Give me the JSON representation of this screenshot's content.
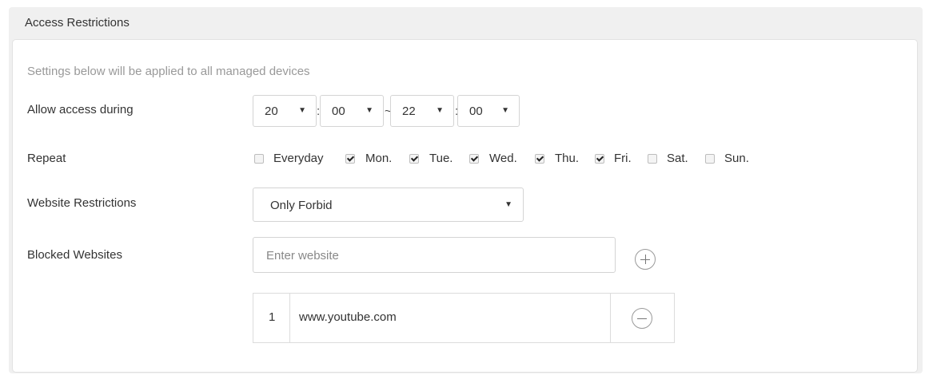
{
  "panel": {
    "title": "Access Restrictions",
    "hint": "Settings below will be applied to all managed devices"
  },
  "access": {
    "label": "Allow access during",
    "start_hour": "20",
    "start_minute": "00",
    "end_hour": "22",
    "end_minute": "00",
    "colon": ":",
    "tilde": "~"
  },
  "repeat": {
    "label": "Repeat",
    "days": [
      {
        "label": "Everyday",
        "checked": false
      },
      {
        "label": "Mon.",
        "checked": true
      },
      {
        "label": "Tue.",
        "checked": true
      },
      {
        "label": "Wed.",
        "checked": true
      },
      {
        "label": "Thu.",
        "checked": true
      },
      {
        "label": "Fri.",
        "checked": true
      },
      {
        "label": "Sat.",
        "checked": false
      },
      {
        "label": "Sun.",
        "checked": false
      }
    ]
  },
  "website_restrictions": {
    "label": "Website Restrictions",
    "value": "Only Forbid"
  },
  "blocked": {
    "label": "Blocked Websites",
    "placeholder": "Enter website",
    "add_icon": "plus-circle-icon",
    "remove_icon": "minus-circle-icon",
    "rows": [
      {
        "index": "1",
        "url": "www.youtube.com"
      }
    ]
  },
  "icons": {
    "dropdown": "triangle-down-icon"
  }
}
